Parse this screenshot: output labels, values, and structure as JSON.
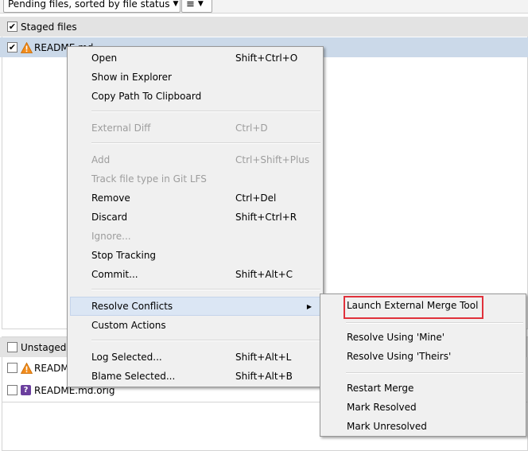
{
  "toolbar": {
    "filter_dropdown_label": "Pending files, sorted by file status",
    "view_dropdown_glyph": "≡"
  },
  "staged": {
    "header": "Staged files",
    "header_checked": true,
    "files": [
      {
        "name": "README.md",
        "checked": true,
        "icon": "warning-icon",
        "selected": true
      }
    ]
  },
  "unstaged": {
    "header": "Unstaged files",
    "header_checked": false,
    "files": [
      {
        "name": "README.md",
        "checked": false,
        "icon": "warning-icon"
      },
      {
        "name": "README.md.orig",
        "checked": false,
        "icon": "question-icon"
      }
    ]
  },
  "context_menu": {
    "items": [
      {
        "label": "Open",
        "shortcut": "Shift+Ctrl+O",
        "enabled": true
      },
      {
        "label": "Show in Explorer",
        "shortcut": "",
        "enabled": true
      },
      {
        "label": "Copy Path To Clipboard",
        "shortcut": "",
        "enabled": true
      },
      {
        "label": "External Diff",
        "shortcut": "Ctrl+D",
        "enabled": false
      },
      {
        "label": "Add",
        "shortcut": "Ctrl+Shift+Plus",
        "enabled": false
      },
      {
        "label": "Track file type in Git LFS",
        "shortcut": "",
        "enabled": false
      },
      {
        "label": "Remove",
        "shortcut": "Ctrl+Del",
        "enabled": true
      },
      {
        "label": "Discard",
        "shortcut": "Shift+Ctrl+R",
        "enabled": true
      },
      {
        "label": "Ignore...",
        "shortcut": "",
        "enabled": false
      },
      {
        "label": "Stop Tracking",
        "shortcut": "",
        "enabled": true
      },
      {
        "label": "Commit...",
        "shortcut": "Shift+Alt+C",
        "enabled": true
      },
      {
        "label": "Resolve Conflicts",
        "shortcut": "",
        "enabled": true,
        "submenu": true,
        "hovered": true
      },
      {
        "label": "Custom Actions",
        "shortcut": "",
        "enabled": true
      },
      {
        "label": "Log Selected...",
        "shortcut": "Shift+Alt+L",
        "enabled": true
      },
      {
        "label": "Blame Selected...",
        "shortcut": "Shift+Alt+B",
        "enabled": true
      }
    ]
  },
  "resolve_submenu": {
    "items": [
      {
        "label": "Launch External Merge Tool",
        "highlighted": true
      },
      {
        "label": "Resolve Using 'Mine'"
      },
      {
        "label": "Resolve Using 'Theirs'"
      },
      {
        "label": "Restart Merge"
      },
      {
        "label": "Mark Resolved"
      },
      {
        "label": "Mark Unresolved"
      }
    ]
  },
  "colors": {
    "selection": "#cbd9e9",
    "menu_background": "#f0f0f0",
    "disabled_text": "#9d9d9d",
    "highlight_border": "#e0313b",
    "warning_icon": "#f28c1c",
    "question_icon": "#6b3f9e"
  }
}
